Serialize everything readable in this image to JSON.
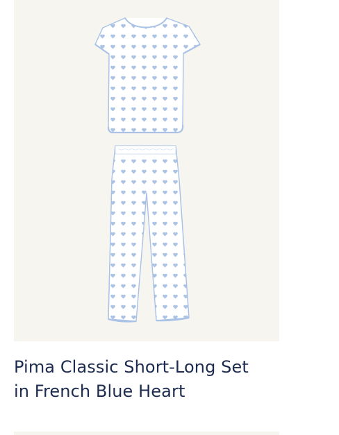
{
  "product": {
    "title_line1": "Pima Classic Short-Long Set",
    "title_line2": "in French Blue Heart",
    "image_icon": "pajama-set-image"
  },
  "colors": {
    "image_background": "#f6f5f0",
    "fabric": "#ffffff",
    "piping": "#a9c2e6",
    "heart_print": "#9fb9df",
    "title_text": "#1d2b4f"
  }
}
